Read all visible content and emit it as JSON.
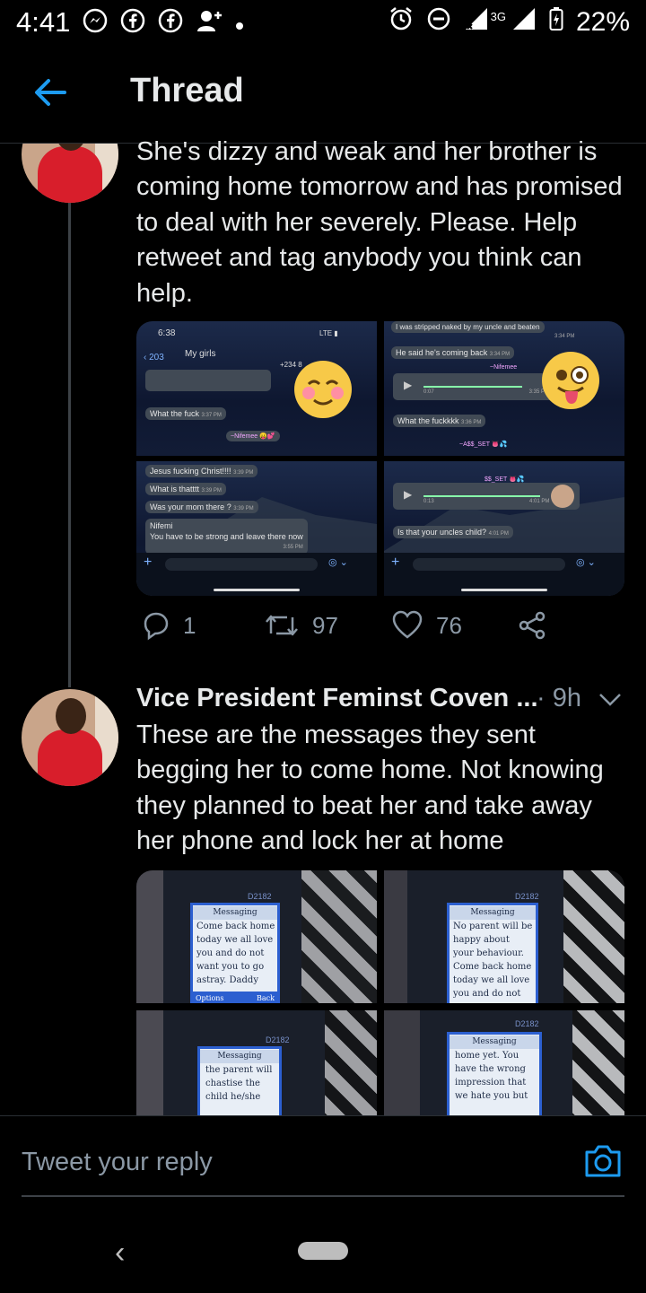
{
  "status_bar": {
    "time": "4:41",
    "network": "3G",
    "battery": "22%"
  },
  "header": {
    "title": "Thread",
    "back_icon": "arrow-left-icon"
  },
  "tweet1": {
    "text": "She's dizzy and weak and her brother is coming home tomorrow and has promised to deal with her severely. Please. Help retweet and tag anybody you think can help.",
    "replies": "1",
    "retweets": "97",
    "likes": "76",
    "screenshots": {
      "tl": {
        "time": "6:38",
        "back_count": "203",
        "chat_name": "My girls",
        "phone_prefix": "+234 8",
        "msg1": "What the fuck",
        "msg1_time": "3:37 PM",
        "sender": "~Nifemee"
      },
      "tr": {
        "msg_top": "I was stripped naked by my uncle and beaten",
        "msg_top_time": "3:34 PM",
        "msg1": "He said he's coming back",
        "msg1_time": "3:34 PM",
        "sender": "~Nifemee",
        "voice_len": "0:07",
        "voice_time": "3:35 PM",
        "msg2": "What the fuckkkk",
        "msg2_time": "3:36 PM",
        "group_sender": "~A$$_SET"
      },
      "bl": {
        "msg1": "Jesus fucking Christ!!!!",
        "msg1_time": "3:39 PM",
        "msg2": "What is thatttt",
        "msg2_time": "3:39 PM",
        "msg3": "Was your mom there ?",
        "msg3_time": "3:39 PM",
        "msg4_name": "Nifemi",
        "msg4": "You have to be strong and leave there now",
        "msg4_time": "3:55 PM"
      },
      "br": {
        "group_sender": "$$_SET",
        "voice_len": "0:13",
        "voice_time": "4:01 PM",
        "msg1": "Is that your uncles child?",
        "msg1_time": "4:01 PM"
      }
    }
  },
  "tweet2": {
    "author": "Vice President Feminst Coven ...",
    "time": "· 9h",
    "text": "These are the messages they sent begging her to come home. Not knowing they planned to beat her and take away her phone and lock her at home",
    "phone_screens": {
      "tl": {
        "model": "D2182",
        "heading": "Messaging",
        "body": "Come back home\ntoday we all love\nyou and do not\nwant you to go\nastray. Daddy",
        "left_soft": "Options",
        "right_soft": "Back"
      },
      "tr": {
        "model": "D2182",
        "heading": "Messaging",
        "body": "No parent will be\nhappy about\nyour behaviour.\nCome back home\ntoday we all love\nyou and do not"
      },
      "bl": {
        "model": "D2182",
        "heading": "Messaging",
        "body": "the parent will\nchastise the\nchild he/she"
      },
      "br": {
        "model": "D2182",
        "heading": "Messaging",
        "body": "home yet. You\nhave the wrong\nimpression that\nwe hate you but"
      }
    }
  },
  "reply": {
    "placeholder": "Tweet your reply"
  },
  "colors": {
    "accent": "#1d9bf0",
    "text": "#e7e9ea",
    "muted": "#8b98a5",
    "background": "#000000"
  }
}
